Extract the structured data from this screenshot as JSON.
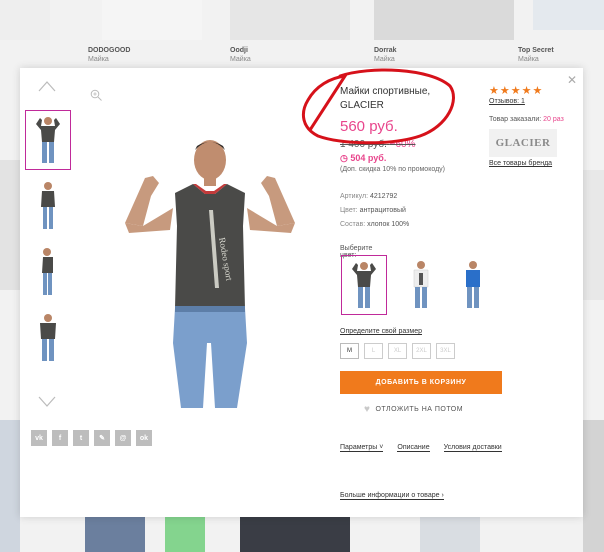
{
  "background": {
    "labels": [
      {
        "brand": "DODOGOOD",
        "type": "Майка"
      },
      {
        "brand": "Oodji",
        "type": "Майка"
      },
      {
        "brand": "Dorrak",
        "type": "Майка"
      },
      {
        "brand": "Top Secret",
        "type": "Майка"
      }
    ]
  },
  "product": {
    "title": "Майки спортивные, GLACIER",
    "price": "560 руб.",
    "old_price": "1 400 руб.",
    "discount": "−60%",
    "club_price": "504 руб.",
    "club_note": "(Доп. скидка 10% по промокоду)",
    "article_label": "Артикул:",
    "article_value": "4212792",
    "color_label": "Цвет:",
    "color_value": "антрацитовый",
    "composition_label": "Состав:",
    "composition_value": "хлопок 100%",
    "choose_color_label": "Выберите цвет:",
    "size_label": "Определите свой размер",
    "sizes": [
      "M",
      "L",
      "XL",
      "2XL",
      "3XL"
    ],
    "add_to_cart": "ДОБАВИТЬ В КОРЗИНУ",
    "save_later": "ОТЛОЖИТЬ НА ПОТОМ",
    "tabs": [
      "Параметры",
      "Описание",
      "Условия доставки"
    ],
    "more_info": "Больше информации о товаре"
  },
  "side": {
    "stars": "★★★★★",
    "reviews": "Отзывов: 1",
    "ordered_label": "Товар заказали:",
    "ordered_count": "20 раз",
    "brand_logo": "GLACIER",
    "brand_all": "Все товары бренда"
  },
  "share_icons": [
    "vk-icon",
    "facebook-icon",
    "twitter-icon",
    "link-icon",
    "mail-icon",
    "odnoklassniki-icon"
  ],
  "colors": {
    "accent_orange": "#f07a1c",
    "accent_pink": "#e8458c",
    "annotation_red": "#d6111a",
    "tank_dark": "#4a4a48",
    "tank_white": "#eeeeee",
    "tank_blue": "#2a6fc9"
  }
}
